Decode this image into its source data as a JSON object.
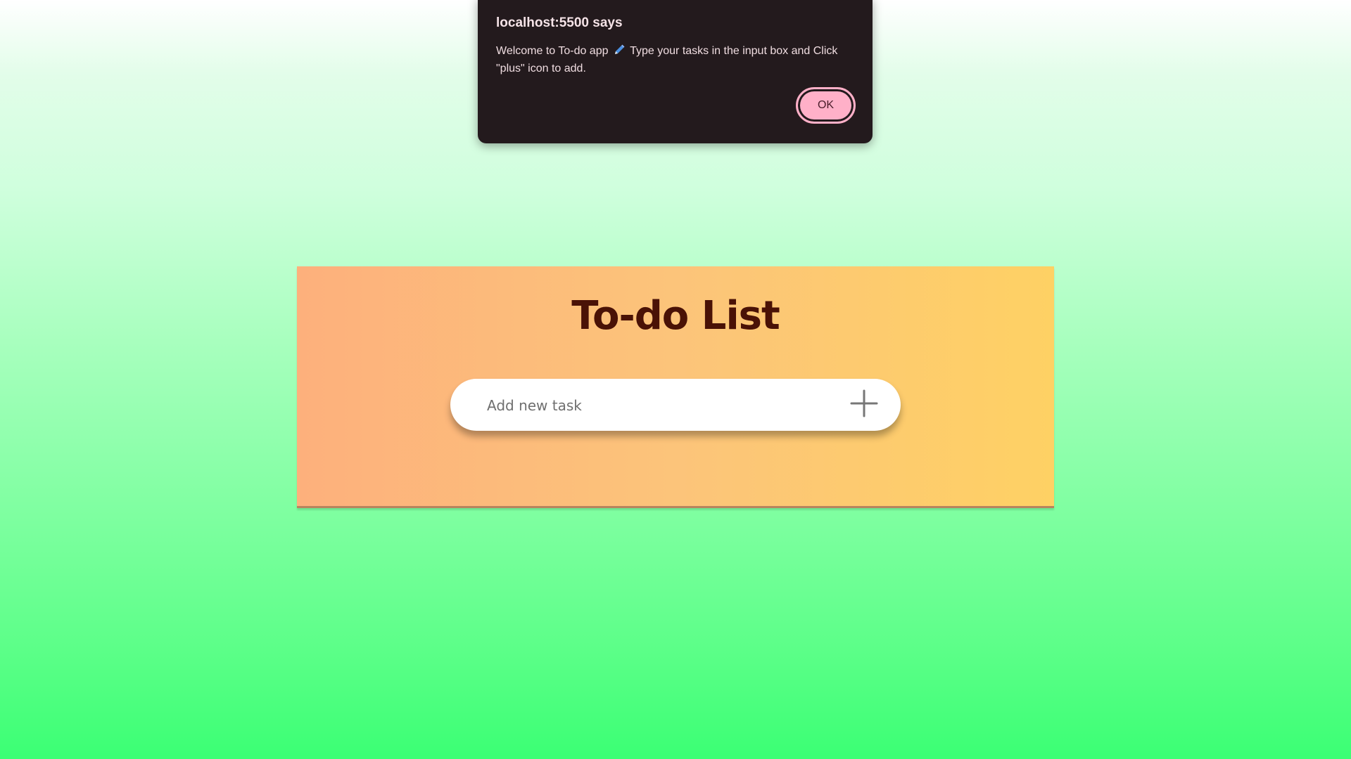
{
  "alert": {
    "title": "localhost:5500 says",
    "message_before_icon": "Welcome to To-do app",
    "message_icon": "pen-icon",
    "message_after_icon": "Type your tasks in the input box and Click \"plus\" icon to add.",
    "ok_label": "OK"
  },
  "todo": {
    "title": "To-do List",
    "input_placeholder": "Add new task",
    "input_value": "",
    "add_icon": "plus-icon"
  },
  "colors": {
    "page_gradient_top": "#ffffff",
    "page_gradient_bottom": "#3bff74",
    "card_gradient_left": "#fdb07c",
    "card_gradient_right": "#fed164",
    "title_color": "#4a1206",
    "alert_background": "#231a1d",
    "ok_button_background": "#ffb0c8"
  }
}
